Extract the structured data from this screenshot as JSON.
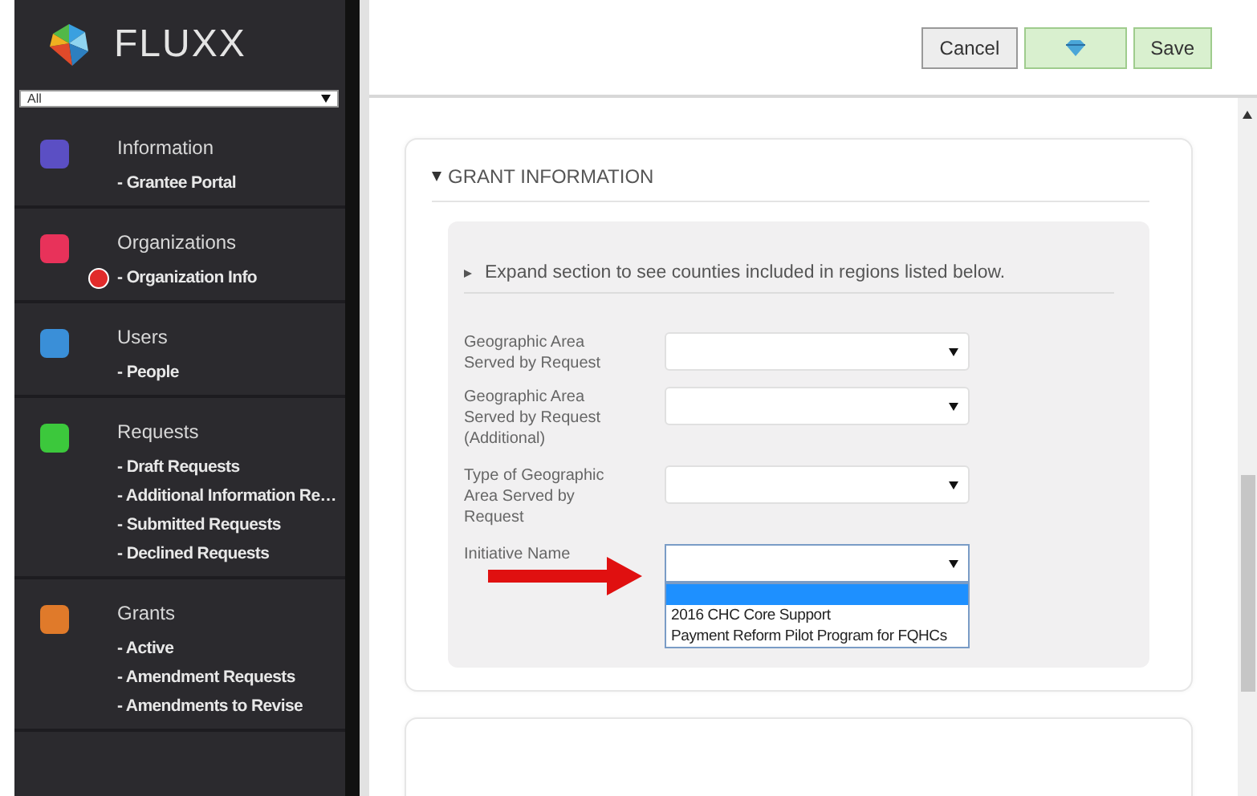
{
  "sidebar": {
    "logo": "FLUXX",
    "filter": "All",
    "sections": [
      {
        "title": "Information",
        "color": "#5b4fc4",
        "items": [
          {
            "label": "- Grantee Portal",
            "alert": false
          }
        ]
      },
      {
        "title": "Organizations",
        "color": "#e8325a",
        "items": [
          {
            "label": "- Organization Info",
            "alert": true
          }
        ]
      },
      {
        "title": "Users",
        "color": "#3a8fd8",
        "items": [
          {
            "label": "- People",
            "alert": false
          }
        ]
      },
      {
        "title": "Requests",
        "color": "#3cc83c",
        "items": [
          {
            "label": "- Draft Requests",
            "alert": false
          },
          {
            "label": "- Additional Information Re…",
            "alert": false
          },
          {
            "label": "- Submitted Requests",
            "alert": false
          },
          {
            "label": "- Declined Requests",
            "alert": false
          }
        ]
      },
      {
        "title": "Grants",
        "color": "#e07a2a",
        "items": [
          {
            "label": "- Active",
            "alert": false
          },
          {
            "label": "- Amendment Requests",
            "alert": false
          },
          {
            "label": "- Amendments to Revise",
            "alert": false
          }
        ]
      }
    ]
  },
  "toolbar": {
    "buttons": [
      {
        "kind": "plain",
        "label": "Cancel"
      },
      {
        "kind": "icon"
      },
      {
        "kind": "confirm",
        "label": "Save"
      }
    ]
  },
  "section": {
    "title": "GRANT INFORMATION",
    "expanded": true,
    "note": {
      "text": "Expand section to see counties included in regions listed below.",
      "expanded": false
    },
    "fields": [
      {
        "label": "Geographic Area Served by Request",
        "open": false
      },
      {
        "label": "Geographic Area Served by Request (Additional)",
        "open": false
      },
      {
        "label": "Type of Geographic Area Served by Request",
        "open": false
      },
      {
        "label": "Initiative Name",
        "open": true,
        "blank_option_selected": true,
        "options": [
          {
            "label": "2016 CHC Core Support",
            "selected": false
          },
          {
            "label": "Payment Reform Pilot Program for FQHCs",
            "selected": false
          }
        ]
      }
    ]
  }
}
